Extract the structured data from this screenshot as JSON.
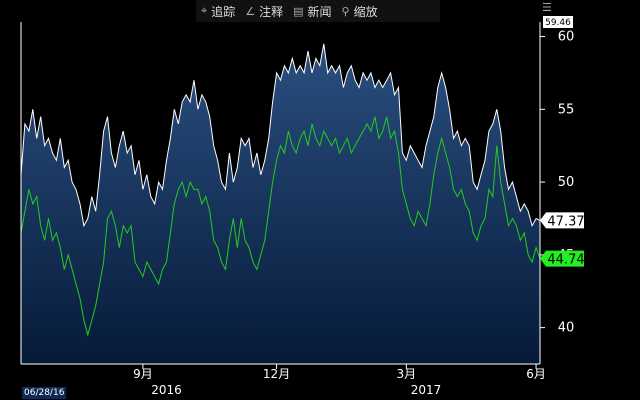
{
  "toolbar": {
    "items": [
      {
        "label": "追踪",
        "icon": "crosshair-icon",
        "glyph": "⌖"
      },
      {
        "label": "注释",
        "icon": "pen-icon",
        "glyph": "∠"
      },
      {
        "label": "新闻",
        "icon": "news-icon",
        "glyph": "▤"
      },
      {
        "label": "缩放",
        "icon": "zoom-icon",
        "glyph": "⚲"
      }
    ]
  },
  "menu_icon": "☰",
  "start_date": "06/28/16",
  "chart_data": {
    "type": "area",
    "title": "",
    "xlabel": "",
    "ylabel": "",
    "ylim": [
      37.5,
      61
    ],
    "y_ticks": [
      40,
      45,
      50,
      55,
      60
    ],
    "x_ticks": [
      {
        "label": "9月",
        "index": 31
      },
      {
        "label": "12月",
        "index": 65
      },
      {
        "label": "3月",
        "index": 98
      },
      {
        "label": "6月",
        "index": 131
      }
    ],
    "year_labels": [
      {
        "label": "2016",
        "index": 37
      },
      {
        "label": "2017",
        "index": 103
      }
    ],
    "top_value_label": "59.46",
    "series": [
      {
        "color": "#ffffff",
        "last_value": "47.37",
        "values": [
          50.5,
          54.0,
          53.5,
          55.0,
          53.0,
          54.5,
          52.5,
          53.0,
          52.0,
          51.5,
          53.0,
          51.0,
          51.5,
          50.0,
          49.5,
          48.5,
          47.0,
          47.5,
          49.0,
          48.0,
          50.5,
          53.5,
          54.5,
          52.0,
          51.0,
          52.5,
          53.5,
          52.0,
          52.5,
          50.5,
          51.5,
          49.5,
          50.5,
          49.0,
          48.5,
          50.0,
          49.5,
          51.5,
          53.0,
          55.0,
          54.0,
          55.5,
          56.0,
          55.5,
          57.0,
          55.0,
          56.0,
          55.5,
          54.5,
          52.5,
          51.5,
          50.0,
          49.5,
          52.0,
          50.0,
          51.0,
          53.0,
          52.5,
          53.0,
          51.0,
          52.0,
          50.5,
          51.5,
          53.0,
          55.5,
          57.5,
          57.0,
          58.0,
          57.5,
          58.5,
          57.5,
          58.0,
          57.5,
          59.0,
          57.5,
          58.5,
          58.0,
          59.5,
          57.5,
          58.0,
          57.5,
          58.0,
          56.5,
          57.5,
          58.0,
          57.0,
          56.5,
          57.5,
          57.0,
          57.5,
          56.5,
          57.0,
          56.5,
          57.0,
          57.5,
          56.0,
          56.5,
          52.0,
          51.5,
          52.5,
          52.0,
          51.5,
          51.0,
          52.5,
          53.5,
          54.5,
          56.5,
          57.5,
          56.5,
          55.0,
          53.0,
          53.5,
          52.5,
          53.0,
          52.5,
          50.0,
          49.5,
          50.5,
          51.5,
          53.5,
          54.0,
          55.0,
          53.5,
          51.0,
          49.5,
          50.0,
          49.0,
          48.0,
          48.5,
          48.0,
          47.0,
          47.5,
          47.37
        ]
      },
      {
        "color": "#22cc22",
        "last_value": "44.74",
        "values": [
          46.5,
          48.0,
          49.5,
          48.5,
          49.0,
          47.0,
          46.0,
          47.5,
          46.0,
          46.5,
          45.5,
          44.0,
          45.0,
          44.0,
          43.0,
          42.0,
          40.5,
          39.5,
          40.5,
          41.5,
          43.0,
          44.5,
          47.5,
          48.0,
          47.0,
          45.5,
          47.0,
          46.5,
          47.0,
          44.5,
          44.0,
          43.5,
          44.5,
          44.0,
          43.5,
          43.0,
          44.0,
          44.5,
          46.5,
          48.5,
          49.5,
          50.0,
          49.0,
          50.0,
          49.5,
          49.5,
          48.5,
          49.0,
          48.0,
          46.0,
          45.5,
          44.5,
          44.0,
          46.0,
          47.5,
          45.5,
          47.5,
          46.0,
          45.5,
          44.5,
          44.0,
          45.0,
          46.0,
          48.0,
          50.0,
          51.5,
          52.5,
          52.0,
          53.5,
          52.5,
          52.0,
          53.0,
          53.5,
          52.5,
          54.0,
          53.0,
          52.5,
          53.5,
          53.0,
          52.5,
          53.0,
          52.0,
          52.5,
          53.0,
          52.0,
          52.5,
          53.0,
          53.5,
          54.0,
          53.5,
          54.5,
          53.0,
          53.5,
          54.5,
          53.0,
          53.5,
          52.0,
          49.5,
          48.5,
          47.5,
          47.0,
          48.0,
          47.5,
          47.0,
          48.5,
          50.5,
          52.0,
          53.0,
          52.0,
          51.0,
          49.5,
          49.0,
          49.5,
          48.5,
          48.0,
          46.5,
          46.0,
          47.0,
          47.5,
          49.5,
          49.0,
          52.5,
          50.0,
          48.5,
          47.0,
          47.5,
          47.0,
          46.0,
          46.5,
          45.0,
          44.5,
          45.5,
          44.74
        ]
      }
    ]
  }
}
